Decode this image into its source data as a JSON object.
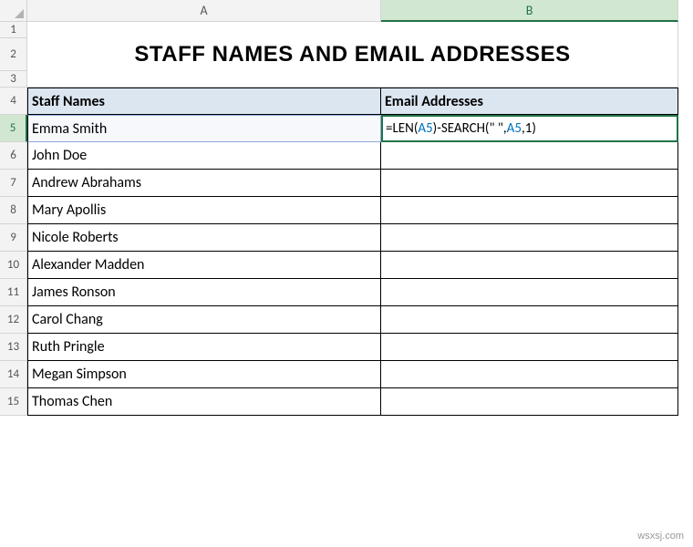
{
  "columns": {
    "A": "A",
    "B": "B"
  },
  "active_column": "B",
  "active_row": "5",
  "title": "STAFF NAMES AND EMAIL ADDRESSES",
  "headers": {
    "staff_names": "Staff Names",
    "email_addresses": "Email Addresses"
  },
  "rows": [
    {
      "num": "1"
    },
    {
      "num": "2"
    },
    {
      "num": "3"
    },
    {
      "num": "4"
    },
    {
      "num": "5"
    },
    {
      "num": "6"
    },
    {
      "num": "7"
    },
    {
      "num": "8"
    },
    {
      "num": "9"
    },
    {
      "num": "10"
    },
    {
      "num": "11"
    },
    {
      "num": "12"
    },
    {
      "num": "13"
    },
    {
      "num": "14"
    },
    {
      "num": "15"
    }
  ],
  "staff": [
    "Emma Smith",
    "John Doe",
    "Andrew Abrahams",
    "Mary Apollis",
    "Nicole Roberts",
    "Alexander Madden",
    "James Ronson",
    "Carol Chang",
    "Ruth Pringle",
    "Megan Simpson",
    "Thomas Chen"
  ],
  "formula": {
    "eq": "=",
    "len": "LEN",
    "open": "(",
    "ref1": "A5",
    "close": ")",
    "dash": "-",
    "search": "SEARCH",
    "quote_space": "\" \"",
    "comma": ",",
    "ref2": "A5",
    "one": "1",
    "full_display": "=LEN(A5)-SEARCH(\" \",A5,1)"
  },
  "watermark": "wsxsj.com"
}
